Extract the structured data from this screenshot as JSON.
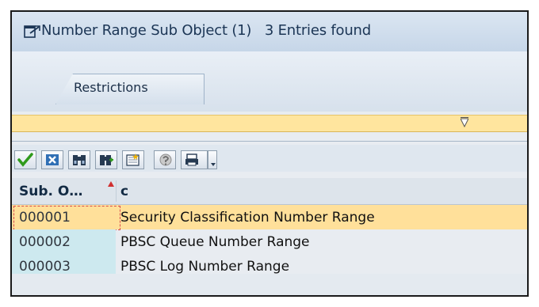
{
  "window": {
    "title": "Number Range Sub Object (1)",
    "entries_found": "3 Entries found"
  },
  "tabs": [
    {
      "label": "Restrictions"
    }
  ],
  "toolbar": {
    "buttons": [
      {
        "icon": "checkmark-icon",
        "name": "continue-button"
      },
      {
        "icon": "cancel-icon",
        "name": "cancel-button"
      },
      {
        "icon": "binoculars-icon",
        "name": "find-button"
      },
      {
        "icon": "find-next-icon",
        "name": "find-next-button"
      },
      {
        "icon": "new-entry-icon",
        "name": "new-entry-button"
      },
      {
        "icon": "help-icon",
        "name": "help-button"
      },
      {
        "icon": "print-icon",
        "name": "print-button"
      }
    ]
  },
  "table": {
    "columns": [
      {
        "label": "Sub. O…"
      },
      {
        "label": "c"
      }
    ],
    "rows": [
      {
        "key": "000001",
        "description": "Security Classification Number Range",
        "selected": true
      },
      {
        "key": "000002",
        "description": "PBSC Queue Number Range",
        "selected": false
      },
      {
        "key": "000003",
        "description": "PBSC Log Number Range",
        "selected": false
      }
    ]
  },
  "colors": {
    "selection": "#ffe09a",
    "key_column": "#cde9ef",
    "title_text": "#1b3555"
  }
}
